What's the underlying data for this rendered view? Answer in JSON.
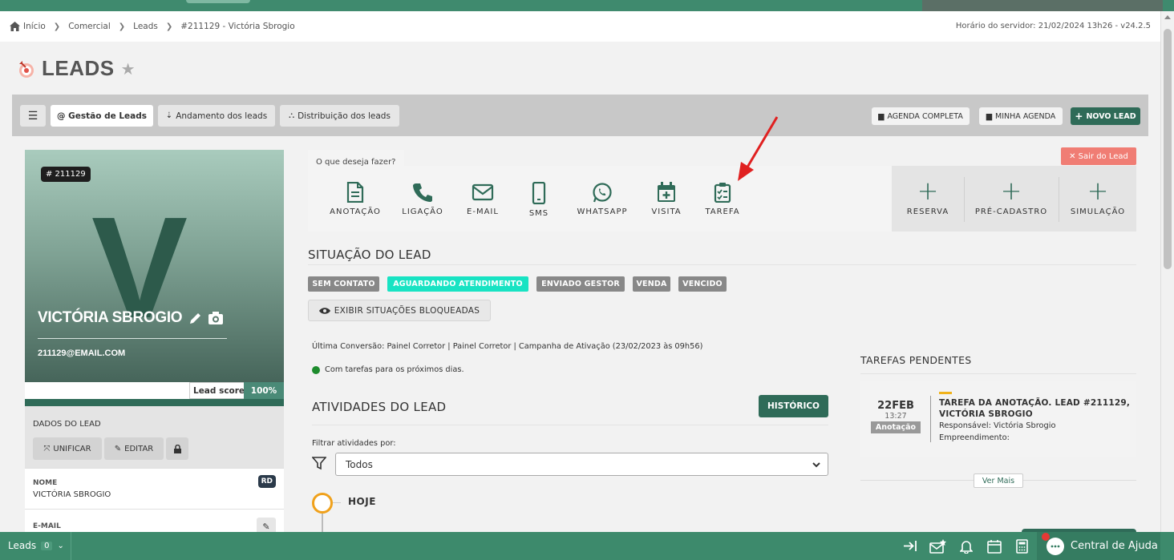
{
  "breadcrumb": [
    "Início",
    "Comercial",
    "Leads",
    "#211129 - Victória Sbrogio"
  ],
  "server_time": "Horário do servidor: 21/02/2024 13h26 - v24.2.5",
  "page": {
    "title": "LEADS"
  },
  "toolbar": {
    "menu_icon": "hamburger-icon",
    "tabs": [
      "@ Gestão de Leads",
      "Andamento dos leads",
      "Distribuição dos leads"
    ],
    "agenda_completa": "AGENDA COMPLETA",
    "minha_agenda": "MINHA AGENDA",
    "novo_lead": "NOVO LEAD"
  },
  "lead": {
    "id": "# 211129",
    "initial": "V",
    "name": "VICTÓRIA SBROGIO",
    "email": "211129@EMAIL.COM",
    "score_label": "Lead score",
    "score_value": "100%"
  },
  "dados": {
    "title": "DADOS DO LEAD",
    "unificar": "UNIFICAR",
    "editar": "EDITAR",
    "fields": [
      {
        "label": "NOME",
        "value": "VICTÓRIA SBROGIO",
        "badge": "RD"
      },
      {
        "label": "E-MAIL",
        "value": ""
      }
    ]
  },
  "actions": {
    "prompt": "O que deseja fazer?",
    "items": [
      {
        "label": "ANOTAÇÃO",
        "icon": "document-icon"
      },
      {
        "label": "LIGAÇÃO",
        "icon": "phone-icon"
      },
      {
        "label": "E-MAIL",
        "icon": "envelope-icon"
      },
      {
        "label": "SMS",
        "icon": "mobile-icon"
      },
      {
        "label": "WHATSAPP",
        "icon": "whatsapp-icon"
      },
      {
        "label": "VISITA",
        "icon": "calendar-plus-icon"
      },
      {
        "label": "TAREFA",
        "icon": "clipboard-check-icon"
      }
    ],
    "plus_items": [
      "RESERVA",
      "PRÉ-CADASTRO",
      "SIMULAÇÃO"
    ],
    "sair": "✕ Sair do Lead"
  },
  "situacao": {
    "title": "SITUAÇÃO DO LEAD",
    "tags": [
      "SEM CONTATO",
      "AGUARDANDO ATENDIMENTO",
      "ENVIADO GESTOR",
      "VENDA",
      "VENCIDO"
    ],
    "exibir": "EXIBIR SITUAÇÕES BLOQUEADAS",
    "ultima_conversao": "Última Conversão: Painel Corretor | Painel Corretor | Campanha de Ativação (23/02/2023 às 09h56)",
    "tarefas_status": "Com tarefas para os próximos dias."
  },
  "atividades": {
    "title": "ATIVIDADES DO LEAD",
    "historico": "HISTÓRICO",
    "filter_label": "Filtrar atividades por:",
    "filter_value": "Todos",
    "timeline_first": "HOJE"
  },
  "tarefas_pendentes": {
    "title": "TAREFAS PENDENTES",
    "task": {
      "day": "22FEB",
      "time": "13:27",
      "type": "Anotação",
      "title": "TAREFA DA ANOTAÇÃO. LEAD #211129, VICTÓRIA SBROGIO",
      "responsavel": "Responsável: Victória Sbrogio",
      "empreendimento": "Empreendimento:"
    },
    "ver_mais": "Ver Mais"
  },
  "bottom": {
    "leads_label": "Leads",
    "leads_count": "0",
    "ajuda": "Central de Ajuda"
  },
  "colors": {
    "brand_green": "#2f6b58",
    "bar_green": "#3d8a6c",
    "tag_cyan": "#18e3c3",
    "tag_gray": "#888888",
    "sair_red": "#f07d74",
    "annotation_arrow": "#e02020"
  }
}
